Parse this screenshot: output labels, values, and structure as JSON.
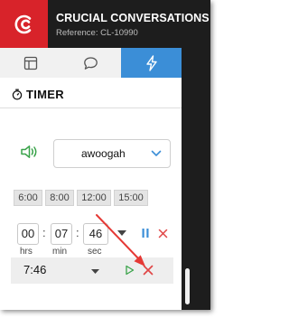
{
  "header": {
    "title": "CRUCIAL CONVERSATIONS",
    "subtitle": "Reference: CL-10990",
    "logo_icon": "cc-logo-icon"
  },
  "tabs": [
    {
      "icon": "layout-icon",
      "active": false
    },
    {
      "icon": "chat-icon",
      "active": false
    },
    {
      "icon": "lightning-icon",
      "active": true
    }
  ],
  "timer": {
    "heading": "TIMER",
    "heading_icon": "stopwatch-icon",
    "speaker_icon": "speaker-icon",
    "sound": {
      "selected": "awoogah"
    },
    "presets": [
      "6:00",
      "8:00",
      "12:00",
      "15:00"
    ],
    "inputs": {
      "hours": "00",
      "minutes": "07",
      "seconds": "46",
      "hours_label": "hrs",
      "minutes_label": "min",
      "seconds_label": "sec"
    },
    "separator": ":",
    "running": {
      "time": "7:46"
    }
  },
  "colors": {
    "brand_red": "#d8232a",
    "header_dark": "#1d1d1d",
    "tab_active": "#3b8ed7",
    "accent_green": "#3aa34a",
    "accent_blue": "#3b8ed7",
    "danger_red": "#e04646",
    "annotation_arrow": "#e53935"
  }
}
